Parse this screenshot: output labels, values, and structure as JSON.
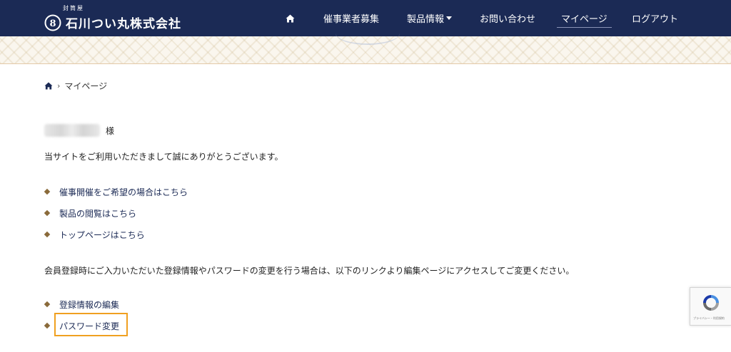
{
  "header": {
    "logo_small": "封筒屋",
    "logo_name": "石川つい丸株式会社",
    "nav": {
      "home_icon": "home-icon",
      "recruit": "催事業者募集",
      "products": "製品情報",
      "contact": "お問い合わせ",
      "mypage": "マイページ",
      "logout": "ログアウト"
    }
  },
  "breadcrumb": {
    "home_icon": "home-icon",
    "current": "マイページ"
  },
  "greeting": {
    "suffix": "様",
    "message": "当サイトをご利用いただきまして誠にありがとうございます。"
  },
  "links": [
    {
      "label": "催事開催をご希望の場合はこちら"
    },
    {
      "label": "製品の閲覧はこちら"
    },
    {
      "label": "トップページはこちら"
    }
  ],
  "member_notice": "会員登録時にご入力いただいた登録情報やパスワードの変更を行う場合は、以下のリンクより編集ページにアクセスしてご変更ください。",
  "account_links": [
    {
      "label": "登録情報の編集"
    },
    {
      "label": "パスワード変更"
    }
  ],
  "recaptcha": {
    "footer": "プライバシー・利用規約"
  },
  "colors": {
    "header_bg": "#1b2a55",
    "link": "#1b2a55",
    "bullet": "#8a6a3a",
    "highlight": "#f0a020"
  }
}
